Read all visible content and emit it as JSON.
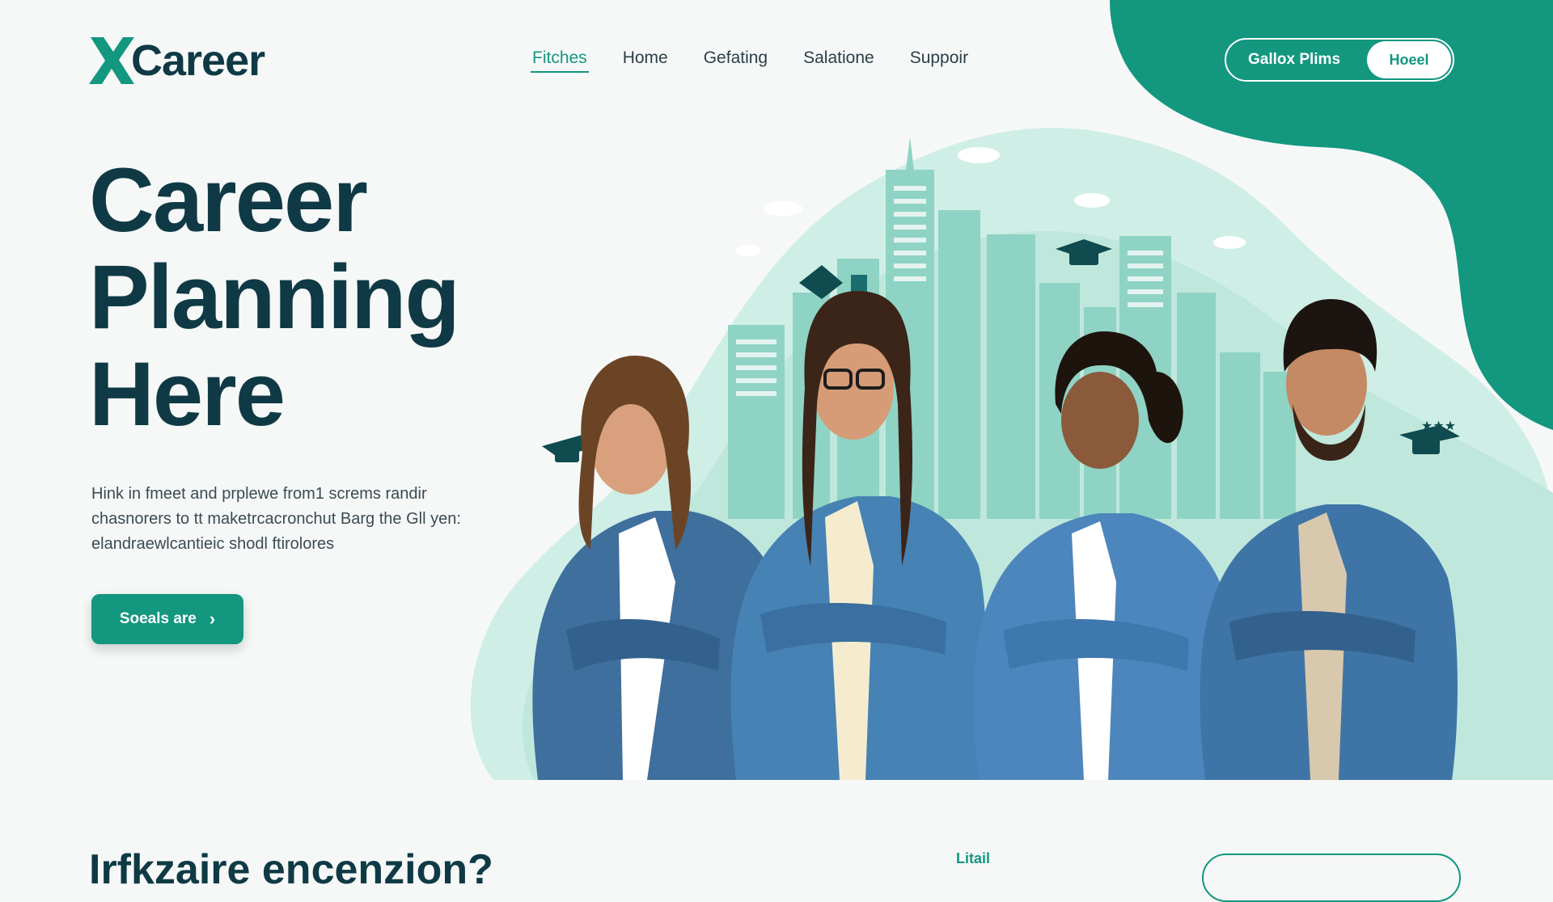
{
  "brand": {
    "logo_text": "Career",
    "logo_mark": "X"
  },
  "nav": {
    "items": [
      {
        "label": "Fitches"
      },
      {
        "label": "Home"
      },
      {
        "label": "Gefating"
      },
      {
        "label": "Salatione"
      },
      {
        "label": "Suppoir"
      }
    ],
    "active_index": 0
  },
  "header_actions": {
    "primary_label": "Gallox Plims",
    "secondary_label": "Hoeel"
  },
  "hero": {
    "title_lines": [
      "Career",
      "Planning",
      "Here"
    ],
    "description": "Hink in fmeet and prplewe from1 screms randir chasnorers to tt maketrcacronchut Barg the Gll yen: elandraewlcantieic shodl ftirolores",
    "cta_label": "Soeals are",
    "cta_icon": "chevron-right-icon"
  },
  "illustration": {
    "subject": "four smiling people in denim jackets with arms crossed",
    "icons": [
      "graduation-cap-icon",
      "building-icon",
      "cloud-icon",
      "star-icon"
    ]
  },
  "bottom": {
    "heading": "Irfkzaire encenzion?",
    "label": "Litail"
  },
  "colors": {
    "accent": "#13977f",
    "accent_light": "#c9ebe3",
    "title": "#0f3a45",
    "background": "#f6f8f8",
    "denim": "#3f74a6"
  }
}
